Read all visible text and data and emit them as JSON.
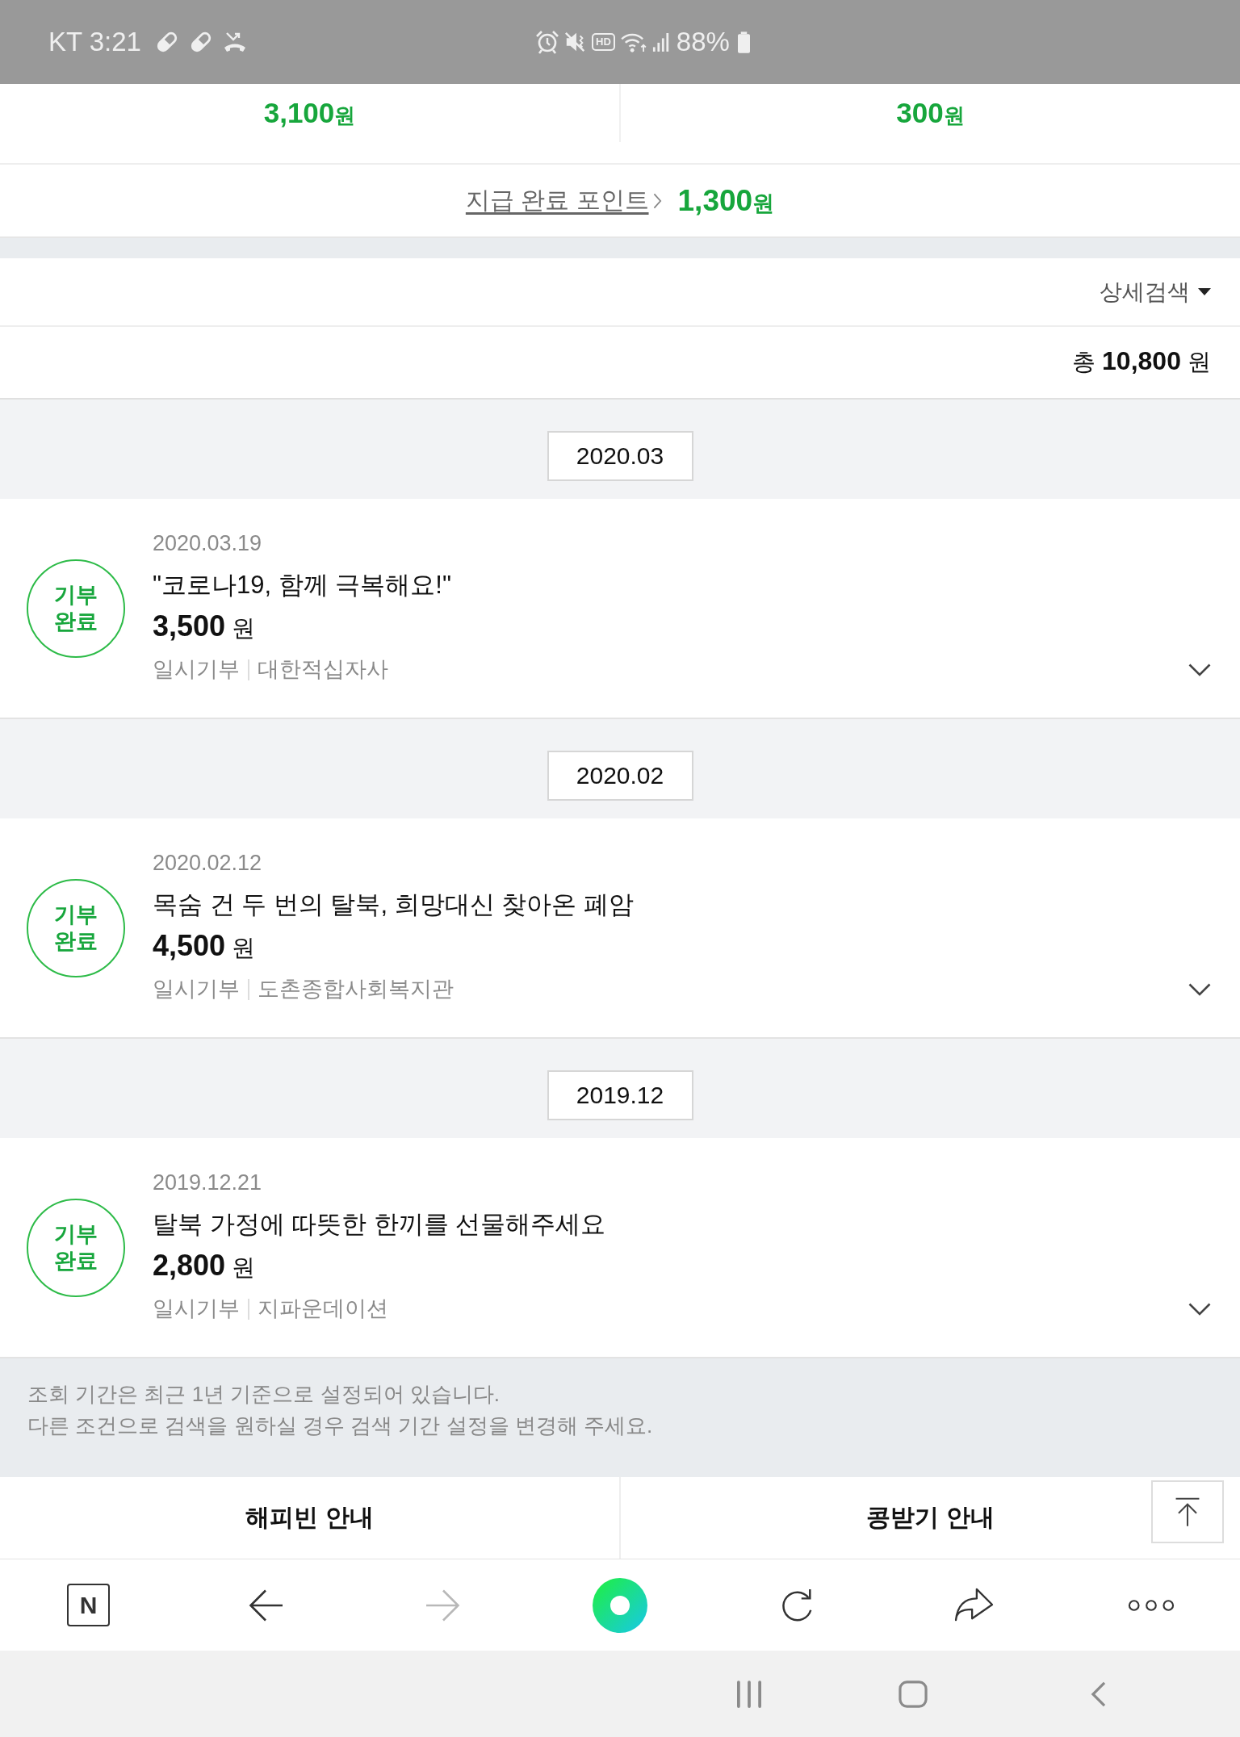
{
  "status_bar": {
    "carrier_time": "KT 3:21",
    "hd": "HD",
    "battery": "88%"
  },
  "points": [
    {
      "amount": "**3,100**원"
    },
    {
      "amount": "**300**원"
    }
  ],
  "paid_points": {
    "link": "지급 완료 포인트",
    "amount": "**1,300**원"
  },
  "filter": {
    "label": "상세검색"
  },
  "total": {
    "text": "총 **10,800** 원"
  },
  "groups": [
    {
      "month": "2020.03",
      "donations": [
        {
          "badge": "기부 완료",
          "date": "2020.03.19",
          "title": "\"코로나19, 함께 극복해요!\"",
          "amount": "**3,500** 원",
          "type": "일시기부",
          "organization": "대한적십자사",
          "expanded": false
        }
      ]
    },
    {
      "month": "2020.02",
      "donations": [
        {
          "badge": "기부 완료",
          "date": "2020.02.12",
          "title": "목숨 건 두 번의 탈북, 희망대신 찾아온 폐암",
          "amount": "**4,500** 원",
          "type": "일시기부",
          "organization": "도촌종합사회복지관",
          "expanded": false
        }
      ]
    },
    {
      "month": "2019.12",
      "donations": [
        {
          "badge": "기부 완료",
          "date": "2019.12.21",
          "title": "탈북 가정에 따뜻한 한끼를 선물해주세요",
          "amount": "**2,800** 원",
          "type": "일시기부",
          "organization": "지파운데이션",
          "expanded": false
        }
      ]
    }
  ],
  "notice": [
    "조회 기간은 최근 1년 기준으로 설정되어 있습니다.",
    "다른 조건으로 검색을 원하실 경우 검색 기간 설정을 변경해 주세요."
  ],
  "footer_buttons": [
    "해피빈 안내",
    "콩받기 안내"
  ],
  "browser_toolbar": {
    "logo": "N",
    "back_disabled": false,
    "forward_disabled": true
  }
}
